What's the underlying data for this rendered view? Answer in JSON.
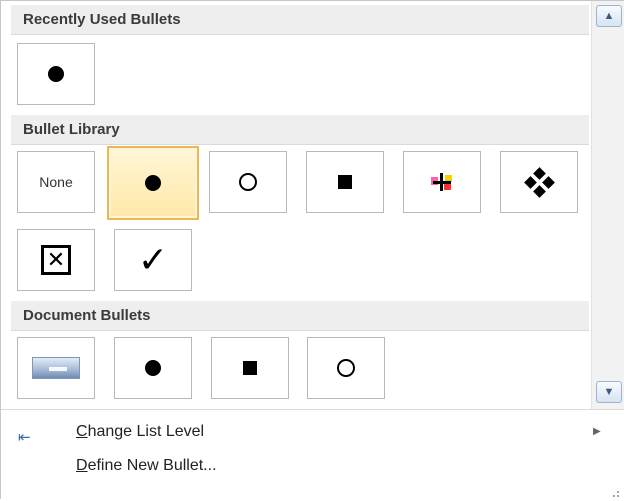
{
  "sections": {
    "recently_used": {
      "title": "Recently Used Bullets"
    },
    "library": {
      "title": "Bullet Library",
      "none_label": "None"
    },
    "document": {
      "title": "Document Bullets"
    }
  },
  "menu": {
    "change_list_level": {
      "accel": "C",
      "rest": "hange List Level"
    },
    "define_new_bullet": {
      "accel": "D",
      "rest": "efine New Bullet..."
    }
  },
  "icons": {
    "bullets": [
      "filled-circle",
      "hollow-circle",
      "filled-square",
      "colored-cross",
      "four-diamonds",
      "boxed-x",
      "checkmark",
      "picture-bullet"
    ],
    "scroll_up": "scroll-up-arrow",
    "scroll_down": "scroll-down-arrow",
    "menu": "indent-arrows-icon"
  },
  "colors": {
    "selected_border": "#e9b659",
    "selected_fill": "#ffe7a8",
    "header_bg": "#eeeeee"
  }
}
